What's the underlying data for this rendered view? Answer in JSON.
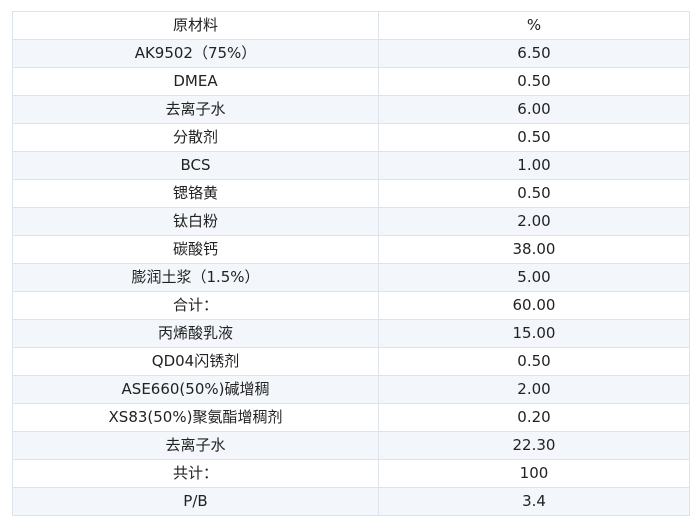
{
  "table": {
    "headers": [
      "原材料",
      "%"
    ],
    "rows": [
      [
        "AK9502（75%）",
        "6.50"
      ],
      [
        "DMEA",
        "0.50"
      ],
      [
        "去离子水",
        "6.00"
      ],
      [
        "分散剂",
        "0.50"
      ],
      [
        "BCS",
        "1.00"
      ],
      [
        "锶铬黄",
        "0.50"
      ],
      [
        "钛白粉",
        "2.00"
      ],
      [
        "碳酸钙",
        "38.00"
      ],
      [
        "膨润土浆（1.5%）",
        "5.00"
      ],
      [
        "合计：",
        "60.00"
      ],
      [
        "丙烯酸乳液",
        "15.00"
      ],
      [
        "QD04闪锈剂",
        "0.50"
      ],
      [
        "ASE660(50%)碱增稠",
        "2.00"
      ],
      [
        "XS83(50%)聚氨酯增稠剂",
        "0.20"
      ],
      [
        "去离子水",
        "22.30"
      ],
      [
        "共计：",
        "100"
      ],
      [
        "P/B",
        "3.4"
      ]
    ]
  }
}
